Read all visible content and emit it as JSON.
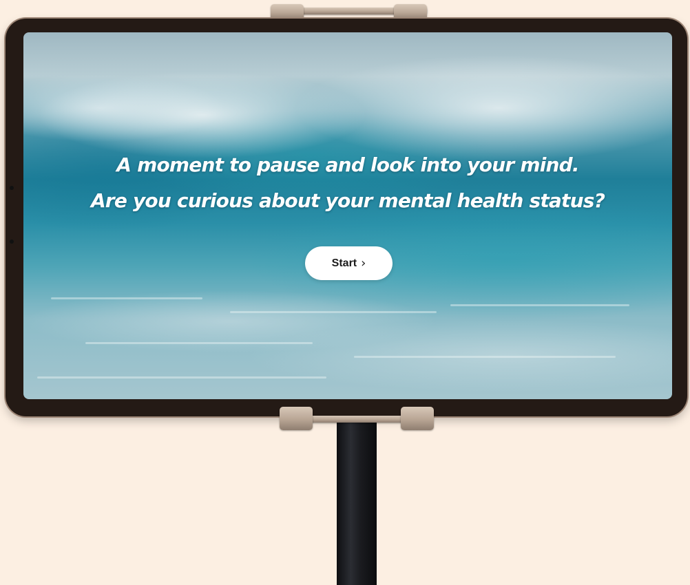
{
  "screen": {
    "headline_line1": "A moment to pause and look into your mind.",
    "headline_line2": "Are you curious about your mental health status?",
    "start_button": {
      "label": "Start",
      "icon": "chevron-right-icon",
      "glyph": "›"
    }
  },
  "colors": {
    "page_background": "#fcefe2",
    "button_background": "#ffffff",
    "headline_text": "#ffffff"
  }
}
